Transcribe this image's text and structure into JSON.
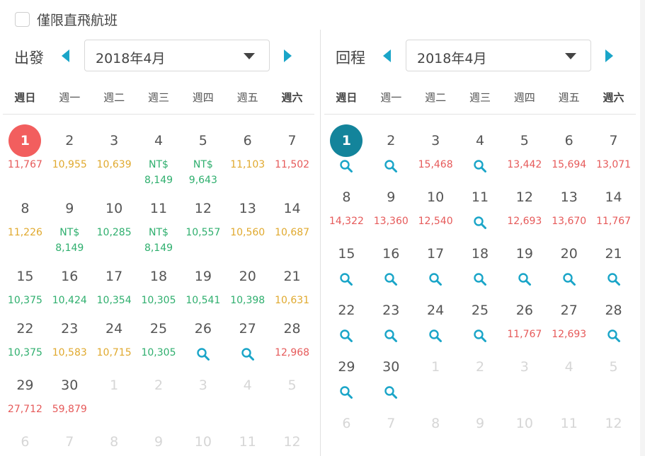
{
  "filter": {
    "direct_only_label": "僅限直飛航班",
    "checked": false
  },
  "colors": {
    "accent": "#1aa5c8",
    "red": "#e65a5a",
    "amber": "#e0a92e",
    "green": "#2faf6e",
    "selected_red": "#f25e5e",
    "selected_teal": "#13849b"
  },
  "weekdays": [
    "週日",
    "週一",
    "週二",
    "週三",
    "週四",
    "週五",
    "週六"
  ],
  "depart": {
    "label": "出發",
    "month": "2018年4月",
    "days": [
      {
        "day": "1",
        "price": [
          "11,767"
        ],
        "color": "red",
        "selected": true
      },
      {
        "day": "2",
        "price": [
          "10,955"
        ],
        "color": "amber"
      },
      {
        "day": "3",
        "price": [
          "10,639"
        ],
        "color": "amber"
      },
      {
        "day": "4",
        "price": [
          "NT$",
          "8,149"
        ],
        "color": "green"
      },
      {
        "day": "5",
        "price": [
          "NT$",
          "9,643"
        ],
        "color": "green"
      },
      {
        "day": "6",
        "price": [
          "11,103"
        ],
        "color": "amber"
      },
      {
        "day": "7",
        "price": [
          "11,502"
        ],
        "color": "red"
      },
      {
        "day": "8",
        "price": [
          "11,226"
        ],
        "color": "amber"
      },
      {
        "day": "9",
        "price": [
          "NT$",
          "8,149"
        ],
        "color": "green"
      },
      {
        "day": "10",
        "price": [
          "10,285"
        ],
        "color": "green"
      },
      {
        "day": "11",
        "price": [
          "NT$",
          "8,149"
        ],
        "color": "green"
      },
      {
        "day": "12",
        "price": [
          "10,557"
        ],
        "color": "green"
      },
      {
        "day": "13",
        "price": [
          "10,560"
        ],
        "color": "amber"
      },
      {
        "day": "14",
        "price": [
          "10,687"
        ],
        "color": "amber"
      },
      {
        "day": "15",
        "price": [
          "10,375"
        ],
        "color": "green"
      },
      {
        "day": "16",
        "price": [
          "10,424"
        ],
        "color": "green"
      },
      {
        "day": "17",
        "price": [
          "10,354"
        ],
        "color": "green"
      },
      {
        "day": "18",
        "price": [
          "10,305"
        ],
        "color": "green"
      },
      {
        "day": "19",
        "price": [
          "10,541"
        ],
        "color": "green"
      },
      {
        "day": "20",
        "price": [
          "10,398"
        ],
        "color": "green"
      },
      {
        "day": "21",
        "price": [
          "10,631"
        ],
        "color": "amber"
      },
      {
        "day": "22",
        "price": [
          "10,375"
        ],
        "color": "green"
      },
      {
        "day": "23",
        "price": [
          "10,583"
        ],
        "color": "amber"
      },
      {
        "day": "24",
        "price": [
          "10,715"
        ],
        "color": "amber"
      },
      {
        "day": "25",
        "price": [
          "10,305"
        ],
        "color": "green"
      },
      {
        "day": "26",
        "search": true
      },
      {
        "day": "27",
        "search": true
      },
      {
        "day": "28",
        "price": [
          "12,968"
        ],
        "color": "red"
      },
      {
        "day": "29",
        "price": [
          "27,712"
        ],
        "color": "red"
      },
      {
        "day": "30",
        "price": [
          "59,879"
        ],
        "color": "red"
      },
      {
        "day": "1",
        "out": true
      },
      {
        "day": "2",
        "out": true
      },
      {
        "day": "3",
        "out": true
      },
      {
        "day": "4",
        "out": true
      },
      {
        "day": "5",
        "out": true
      },
      {
        "day": "6",
        "out": true
      },
      {
        "day": "7",
        "out": true
      },
      {
        "day": "8",
        "out": true
      },
      {
        "day": "9",
        "out": true
      },
      {
        "day": "10",
        "out": true
      },
      {
        "day": "11",
        "out": true
      },
      {
        "day": "12",
        "out": true
      }
    ]
  },
  "return": {
    "label": "回程",
    "month": "2018年4月",
    "days": [
      {
        "day": "1",
        "search": true,
        "selected": true
      },
      {
        "day": "2",
        "search": true
      },
      {
        "day": "3",
        "price": [
          "15,468"
        ],
        "color": "red"
      },
      {
        "day": "4",
        "search": true
      },
      {
        "day": "5",
        "price": [
          "13,442"
        ],
        "color": "red"
      },
      {
        "day": "6",
        "price": [
          "15,694"
        ],
        "color": "red"
      },
      {
        "day": "7",
        "price": [
          "13,071"
        ],
        "color": "red"
      },
      {
        "day": "8",
        "price": [
          "14,322"
        ],
        "color": "red"
      },
      {
        "day": "9",
        "price": [
          "13,360"
        ],
        "color": "red"
      },
      {
        "day": "10",
        "price": [
          "12,540"
        ],
        "color": "red"
      },
      {
        "day": "11",
        "search": true
      },
      {
        "day": "12",
        "price": [
          "12,693"
        ],
        "color": "red"
      },
      {
        "day": "13",
        "price": [
          "13,670"
        ],
        "color": "red"
      },
      {
        "day": "14",
        "price": [
          "11,767"
        ],
        "color": "red"
      },
      {
        "day": "15",
        "search": true
      },
      {
        "day": "16",
        "search": true
      },
      {
        "day": "17",
        "search": true
      },
      {
        "day": "18",
        "search": true
      },
      {
        "day": "19",
        "search": true
      },
      {
        "day": "20",
        "search": true
      },
      {
        "day": "21",
        "search": true
      },
      {
        "day": "22",
        "search": true
      },
      {
        "day": "23",
        "search": true
      },
      {
        "day": "24",
        "search": true
      },
      {
        "day": "25",
        "search": true
      },
      {
        "day": "26",
        "price": [
          "11,767"
        ],
        "color": "red"
      },
      {
        "day": "27",
        "price": [
          "12,693"
        ],
        "color": "red"
      },
      {
        "day": "28",
        "search": true
      },
      {
        "day": "29",
        "search": true
      },
      {
        "day": "30",
        "search": true
      },
      {
        "day": "1",
        "out": true
      },
      {
        "day": "2",
        "out": true
      },
      {
        "day": "3",
        "out": true
      },
      {
        "day": "4",
        "out": true
      },
      {
        "day": "5",
        "out": true
      },
      {
        "day": "6",
        "out": true
      },
      {
        "day": "7",
        "out": true
      },
      {
        "day": "8",
        "out": true
      },
      {
        "day": "9",
        "out": true
      },
      {
        "day": "10",
        "out": true
      },
      {
        "day": "11",
        "out": true
      },
      {
        "day": "12",
        "out": true
      }
    ]
  }
}
